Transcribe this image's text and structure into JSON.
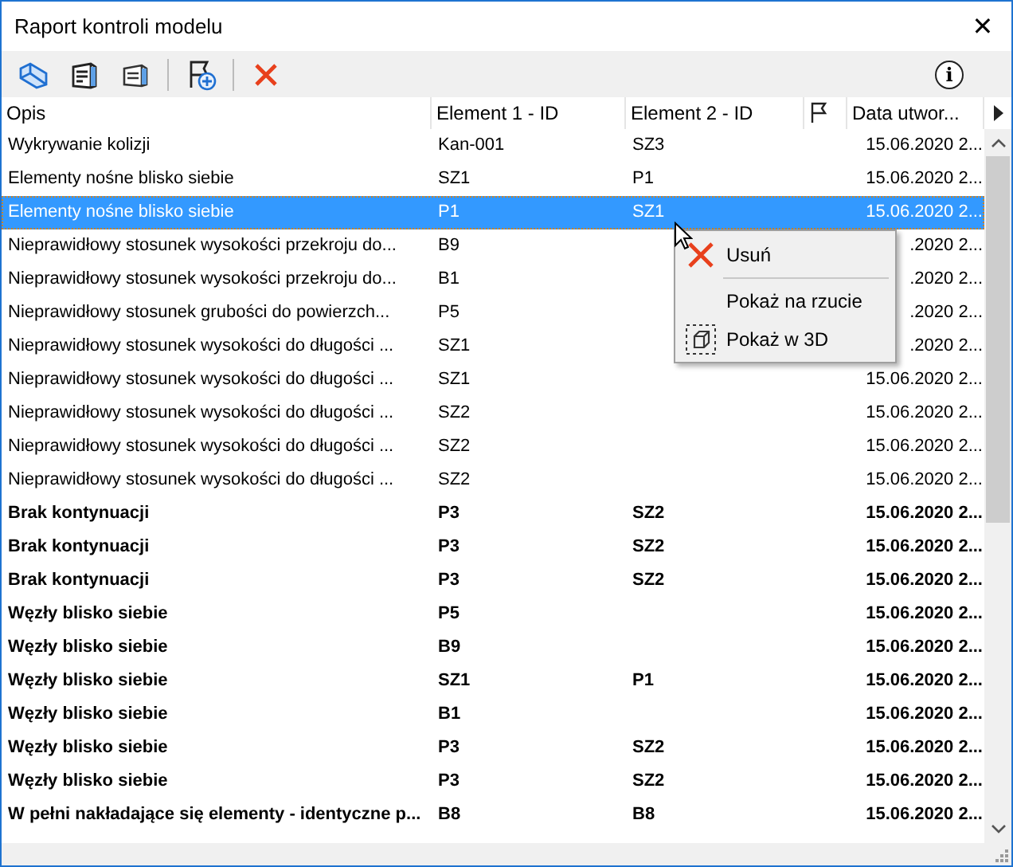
{
  "window": {
    "title": "Raport kontroli modelu",
    "close": "✕"
  },
  "toolbar": {
    "info": "i"
  },
  "table": {
    "columns": [
      "Opis",
      "Element 1 - ID",
      "Element 2 - ID",
      "",
      "Data utwor..."
    ],
    "rows": [
      {
        "opis": "Wykrywanie kolizji",
        "e1": "Kan-001",
        "e2": "SZ3",
        "date": "15.06.2020 2...",
        "bold": false,
        "selected": false
      },
      {
        "opis": "Elementy nośne blisko siebie",
        "e1": "SZ1",
        "e2": "P1",
        "date": "15.06.2020 2...",
        "bold": false,
        "selected": false
      },
      {
        "opis": "Elementy nośne blisko siebie",
        "e1": "P1",
        "e2": "SZ1",
        "date": "15.06.2020 2...",
        "bold": false,
        "selected": true
      },
      {
        "opis": "Nieprawidłowy stosunek wysokości przekroju do...",
        "e1": "B9",
        "e2": "",
        "date": ".2020 2...",
        "bold": false,
        "selected": false
      },
      {
        "opis": "Nieprawidłowy stosunek wysokości przekroju do...",
        "e1": "B1",
        "e2": "",
        "date": ".2020 2...",
        "bold": false,
        "selected": false
      },
      {
        "opis": "Nieprawidłowy stosunek grubości do powierzch...",
        "e1": "P5",
        "e2": "",
        "date": ".2020 2...",
        "bold": false,
        "selected": false
      },
      {
        "opis": "Nieprawidłowy stosunek wysokości do długości ...",
        "e1": "SZ1",
        "e2": "",
        "date": ".2020 2...",
        "bold": false,
        "selected": false
      },
      {
        "opis": "Nieprawidłowy stosunek wysokości do długości ...",
        "e1": "SZ1",
        "e2": "",
        "date": "15.06.2020 2...",
        "bold": false,
        "selected": false
      },
      {
        "opis": "Nieprawidłowy stosunek wysokości do długości ...",
        "e1": "SZ2",
        "e2": "",
        "date": "15.06.2020 2...",
        "bold": false,
        "selected": false
      },
      {
        "opis": "Nieprawidłowy stosunek wysokości do długości ...",
        "e1": "SZ2",
        "e2": "",
        "date": "15.06.2020 2...",
        "bold": false,
        "selected": false
      },
      {
        "opis": "Nieprawidłowy stosunek wysokości do długości ...",
        "e1": "SZ2",
        "e2": "",
        "date": "15.06.2020 2...",
        "bold": false,
        "selected": false
      },
      {
        "opis": "Brak kontynuacji",
        "e1": "P3",
        "e2": "SZ2",
        "date": "15.06.2020 2...",
        "bold": true,
        "selected": false
      },
      {
        "opis": "Brak kontynuacji",
        "e1": "P3",
        "e2": "SZ2",
        "date": "15.06.2020 2...",
        "bold": true,
        "selected": false
      },
      {
        "opis": "Brak kontynuacji",
        "e1": "P3",
        "e2": "SZ2",
        "date": "15.06.2020 2...",
        "bold": true,
        "selected": false
      },
      {
        "opis": "Węzły blisko siebie",
        "e1": "P5",
        "e2": "",
        "date": "15.06.2020 2...",
        "bold": true,
        "selected": false
      },
      {
        "opis": "Węzły blisko siebie",
        "e1": "B9",
        "e2": "",
        "date": "15.06.2020 2...",
        "bold": true,
        "selected": false
      },
      {
        "opis": "Węzły blisko siebie",
        "e1": "SZ1",
        "e2": "P1",
        "date": "15.06.2020 2...",
        "bold": true,
        "selected": false
      },
      {
        "opis": "Węzły blisko siebie",
        "e1": "B1",
        "e2": "",
        "date": "15.06.2020 2...",
        "bold": true,
        "selected": false
      },
      {
        "opis": "Węzły blisko siebie",
        "e1": "P3",
        "e2": "SZ2",
        "date": "15.06.2020 2...",
        "bold": true,
        "selected": false
      },
      {
        "opis": "Węzły blisko siebie",
        "e1": "P3",
        "e2": "SZ2",
        "date": "15.06.2020 2...",
        "bold": true,
        "selected": false
      },
      {
        "opis": "W pełni nakładające się elementy - identyczne p...",
        "e1": "B8",
        "e2": "B8",
        "date": "15.06.2020 2...",
        "bold": true,
        "selected": false
      }
    ]
  },
  "context_menu": {
    "items": [
      {
        "kind": "delete",
        "label": "Usuń"
      },
      {
        "kind": "separator"
      },
      {
        "kind": "plain",
        "label": "Pokaż na rzucie"
      },
      {
        "kind": "view3d",
        "label": "Pokaż w 3D"
      }
    ]
  }
}
